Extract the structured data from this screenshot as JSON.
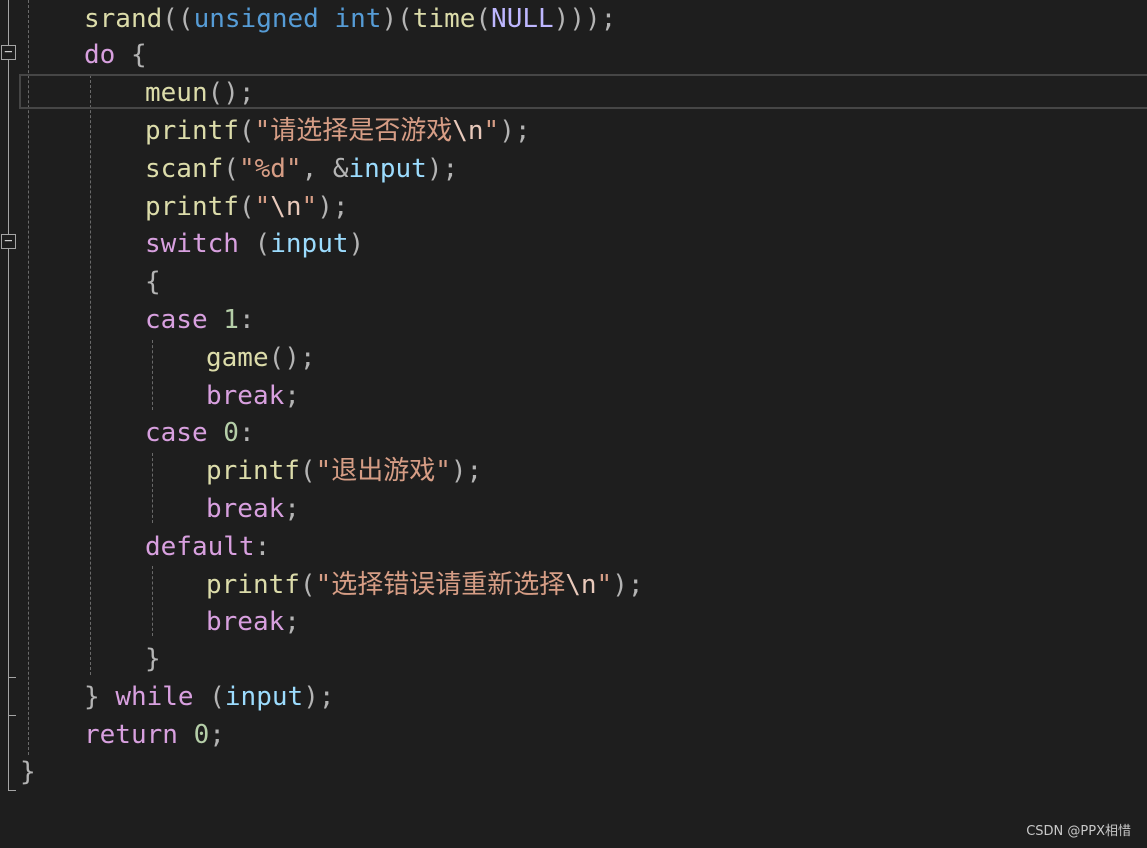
{
  "editor": {
    "lines": [
      [
        {
          "t": "srand",
          "c": "fn"
        },
        {
          "t": "((",
          "c": "pun"
        },
        {
          "t": "unsigned",
          "c": "kw"
        },
        {
          "t": " ",
          "c": "pun"
        },
        {
          "t": "int",
          "c": "kw"
        },
        {
          "t": ")(",
          "c": "pun"
        },
        {
          "t": "time",
          "c": "fn"
        },
        {
          "t": "(",
          "c": "pun"
        },
        {
          "t": "NULL",
          "c": "mac-null"
        },
        {
          "t": ")));",
          "c": "pun"
        }
      ],
      [
        {
          "t": "do",
          "c": "ctl"
        },
        {
          "t": " {",
          "c": "pun"
        }
      ],
      [
        {
          "t": "meun",
          "c": "fn"
        },
        {
          "t": "();",
          "c": "pun"
        }
      ],
      [
        {
          "t": "printf",
          "c": "fn"
        },
        {
          "t": "(",
          "c": "pun"
        },
        {
          "t": "\"请选择是否游戏",
          "c": "str"
        },
        {
          "t": "\\n",
          "c": "esc"
        },
        {
          "t": "\"",
          "c": "str"
        },
        {
          "t": ");",
          "c": "pun"
        }
      ],
      [
        {
          "t": "scanf",
          "c": "fn"
        },
        {
          "t": "(",
          "c": "pun"
        },
        {
          "t": "\"%d\"",
          "c": "str"
        },
        {
          "t": ", &",
          "c": "pun"
        },
        {
          "t": "input",
          "c": "var"
        },
        {
          "t": ");",
          "c": "pun"
        }
      ],
      [
        {
          "t": "printf",
          "c": "fn"
        },
        {
          "t": "(",
          "c": "pun"
        },
        {
          "t": "\"",
          "c": "str"
        },
        {
          "t": "\\n",
          "c": "esc"
        },
        {
          "t": "\"",
          "c": "str"
        },
        {
          "t": ");",
          "c": "pun"
        }
      ],
      [
        {
          "t": "switch",
          "c": "ctl"
        },
        {
          "t": " (",
          "c": "pun"
        },
        {
          "t": "input",
          "c": "var"
        },
        {
          "t": ")",
          "c": "pun"
        }
      ],
      [
        {
          "t": "{",
          "c": "pun"
        }
      ],
      [
        {
          "t": "case",
          "c": "ctl"
        },
        {
          "t": " ",
          "c": "pun"
        },
        {
          "t": "1",
          "c": "num"
        },
        {
          "t": ":",
          "c": "pun"
        }
      ],
      [
        {
          "t": "game",
          "c": "fn"
        },
        {
          "t": "();",
          "c": "pun"
        }
      ],
      [
        {
          "t": "break",
          "c": "ctl"
        },
        {
          "t": ";",
          "c": "pun"
        }
      ],
      [
        {
          "t": "case",
          "c": "ctl"
        },
        {
          "t": " ",
          "c": "pun"
        },
        {
          "t": "0",
          "c": "num"
        },
        {
          "t": ":",
          "c": "pun"
        }
      ],
      [
        {
          "t": "printf",
          "c": "fn"
        },
        {
          "t": "(",
          "c": "pun"
        },
        {
          "t": "\"退出游戏\"",
          "c": "str"
        },
        {
          "t": ");",
          "c": "pun"
        }
      ],
      [
        {
          "t": "break",
          "c": "ctl"
        },
        {
          "t": ";",
          "c": "pun"
        }
      ],
      [
        {
          "t": "default",
          "c": "ctl"
        },
        {
          "t": ":",
          "c": "pun"
        }
      ],
      [
        {
          "t": "printf",
          "c": "fn"
        },
        {
          "t": "(",
          "c": "pun"
        },
        {
          "t": "\"选择错误请重新选择",
          "c": "str"
        },
        {
          "t": "\\n",
          "c": "esc"
        },
        {
          "t": "\"",
          "c": "str"
        },
        {
          "t": ");",
          "c": "pun"
        }
      ],
      [
        {
          "t": "break",
          "c": "ctl"
        },
        {
          "t": ";",
          "c": "pun"
        }
      ],
      [
        {
          "t": "}",
          "c": "pun"
        }
      ],
      [
        {
          "t": "}",
          "c": "pun"
        },
        {
          "t": " ",
          "c": "pun"
        },
        {
          "t": "while",
          "c": "ctl"
        },
        {
          "t": " (",
          "c": "pun"
        },
        {
          "t": "input",
          "c": "var"
        },
        {
          "t": ");",
          "c": "pun"
        }
      ],
      [
        {
          "t": "return",
          "c": "ctl"
        },
        {
          "t": " ",
          "c": "pun"
        },
        {
          "t": "0",
          "c": "num"
        },
        {
          "t": ";",
          "c": "pun"
        }
      ],
      [
        {
          "t": "}",
          "c": "pun"
        }
      ]
    ],
    "fold_glyph": "−"
  },
  "watermark": "CSDN @PPX相惜",
  "colors": {
    "background": "#1e1e1e",
    "function": "#dcdcaa",
    "keyword": "#569cd6",
    "control": "#d8a0df",
    "variable": "#9cdcfe",
    "string": "#d69d85",
    "number": "#b5cea8",
    "punctuation": "#b4b4b4"
  }
}
